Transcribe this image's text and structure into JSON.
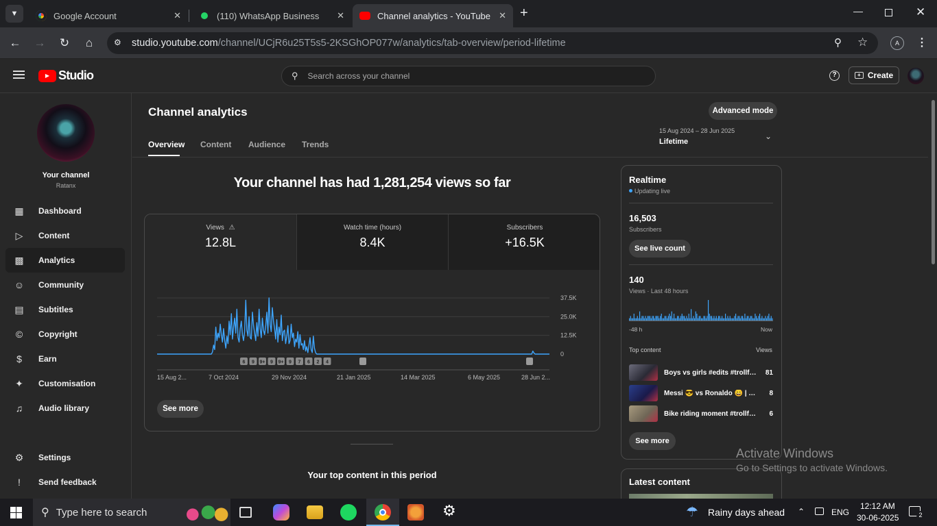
{
  "browser": {
    "tabs": [
      {
        "title": "Google Account",
        "icon": "google-icon"
      },
      {
        "title": "(110) WhatsApp Business",
        "icon": "whatsapp-icon"
      },
      {
        "title": "Channel analytics - YouTube Stu",
        "icon": "youtube-icon",
        "active": true
      }
    ],
    "url_host": "studio.youtube.com",
    "url_path": "/channel/UCjR6u25T5s5-2KSGhOP077w/analytics/tab-overview/period-lifetime"
  },
  "header": {
    "logo_text": "Studio",
    "search_placeholder": "Search across your channel",
    "create_label": "Create"
  },
  "sidebar": {
    "channel_title": "Your channel",
    "channel_name": "Ratanx",
    "items": [
      {
        "label": "Dashboard",
        "icon": "dashboard-icon"
      },
      {
        "label": "Content",
        "icon": "content-icon"
      },
      {
        "label": "Analytics",
        "icon": "analytics-icon"
      },
      {
        "label": "Community",
        "icon": "community-icon"
      },
      {
        "label": "Subtitles",
        "icon": "subtitles-icon"
      },
      {
        "label": "Copyright",
        "icon": "copyright-icon"
      },
      {
        "label": "Earn",
        "icon": "earn-icon"
      },
      {
        "label": "Customisation",
        "icon": "customisation-icon"
      },
      {
        "label": "Audio library",
        "icon": "audio-library-icon"
      }
    ],
    "settings_label": "Settings",
    "feedback_label": "Send feedback"
  },
  "main": {
    "title": "Channel analytics",
    "advanced_mode_label": "Advanced mode",
    "tabs": [
      "Overview",
      "Content",
      "Audience",
      "Trends"
    ],
    "date_range": "15 Aug 2024 – 28 Jun 2025",
    "period": "Lifetime",
    "headline": "Your channel has had 1,281,254 views so far",
    "metrics": [
      {
        "label": "Views",
        "value": "12.8L"
      },
      {
        "label": "Watch time (hours)",
        "value": "8.4K"
      },
      {
        "label": "Subscribers",
        "value": "+16.5K"
      }
    ],
    "see_more_label": "See more",
    "top_content_heading": "Your top content in this period"
  },
  "chart_data": {
    "type": "line",
    "series_color": "#3ea6ff",
    "x_tick_labels": [
      "15 Aug 2...",
      "7 Oct 2024",
      "29 Nov 2024",
      "21 Jan 2025",
      "14 Mar 2025",
      "6 May 2025",
      "28 Jun 2..."
    ],
    "y_tick_labels": [
      "37.5K",
      "25.0K",
      "12.5K",
      "0"
    ],
    "ylim": [
      0,
      37500
    ],
    "grid": true,
    "marker_labels": [
      "6",
      "9",
      "9+",
      "9",
      "9+",
      "9",
      "7",
      "6",
      "2",
      "4"
    ],
    "values": [
      0,
      0,
      0,
      0,
      0,
      0,
      0,
      0,
      0,
      0,
      0,
      0,
      0,
      0,
      0,
      0,
      0,
      0,
      0,
      0,
      0,
      0,
      0,
      0,
      0,
      0,
      0,
      0,
      0,
      0,
      0,
      0,
      0,
      0,
      0,
      0,
      0,
      0,
      0,
      0,
      0,
      0,
      0,
      0,
      0,
      0,
      0,
      0,
      0,
      0,
      1500,
      6000,
      3000,
      18000,
      9000,
      14000,
      11000,
      20000,
      13000,
      8000,
      17000,
      9000,
      4000,
      12000,
      7000,
      22000,
      13000,
      27000,
      10000,
      18000,
      24000,
      14000,
      30000,
      11000,
      8000,
      17000,
      22000,
      13000,
      9000,
      15000,
      36000,
      16000,
      12000,
      25000,
      11000,
      10000,
      28000,
      19000,
      14000,
      9000,
      21000,
      12000,
      30000,
      17000,
      11000,
      24000,
      16000,
      13000,
      19000,
      28000,
      14000,
      37500,
      20000,
      15000,
      31000,
      22000,
      17000,
      10000,
      23000,
      8000,
      18000,
      13000,
      26000,
      9000,
      15000,
      16000,
      7000,
      12000,
      19000,
      7000,
      9000,
      20000,
      11000,
      14000,
      5000,
      10000,
      8000,
      15000,
      4000,
      13000,
      6000,
      7000,
      3000,
      9000,
      2000,
      5000,
      1000,
      6000,
      11000,
      3000,
      1000,
      12000,
      4000,
      1000,
      0,
      0,
      0,
      0,
      0,
      0,
      0,
      0,
      0,
      0,
      0,
      0,
      0,
      0,
      0,
      0,
      0,
      0,
      0,
      0,
      0,
      0,
      0,
      0,
      0,
      0,
      0,
      0,
      0,
      0,
      0,
      0,
      0,
      0,
      0,
      0,
      0,
      0,
      0,
      0,
      0,
      0,
      0,
      0,
      0,
      0,
      0,
      0,
      0,
      0,
      0,
      0,
      0,
      0,
      0,
      0,
      0,
      0,
      0,
      0,
      0,
      0,
      0,
      0,
      0,
      0,
      0,
      0,
      0,
      0,
      0,
      0,
      0,
      0,
      0,
      0,
      0,
      0,
      0,
      0,
      0,
      0,
      0,
      0,
      0,
      0,
      0,
      0,
      0,
      0,
      0,
      0,
      0,
      0,
      0,
      0,
      0,
      0,
      0,
      0,
      0,
      0,
      0,
      0,
      0,
      0,
      0,
      0,
      0,
      0,
      0,
      0,
      0,
      0,
      0,
      0,
      0,
      0,
      0,
      0,
      0,
      0,
      0,
      0,
      0,
      0,
      0,
      0,
      0,
      0,
      0,
      0,
      0,
      0,
      0,
      0,
      0,
      0,
      0,
      0,
      0,
      0,
      0,
      0,
      0,
      0,
      0,
      0,
      0,
      0,
      0,
      0,
      0,
      0,
      0,
      0,
      0,
      0,
      0,
      0,
      0,
      0,
      0,
      0,
      0,
      0,
      0,
      0,
      0,
      0,
      0,
      0,
      0,
      0,
      0,
      0,
      0,
      0,
      0,
      0,
      0,
      0,
      0,
      0,
      0,
      0,
      0,
      0,
      0,
      0,
      0,
      0,
      0,
      0,
      0,
      2000,
      800,
      0,
      0,
      0,
      0,
      0,
      0,
      0,
      0,
      0,
      0,
      0,
      0,
      0,
      0
    ]
  },
  "realtime": {
    "title": "Realtime",
    "status": "Updating live",
    "subscribers_value": "16,503",
    "subscribers_label": "Subscribers",
    "see_live_label": "See live count",
    "views_value": "140",
    "views_label": "Views · Last 48 hours",
    "bar_values": [
      1,
      2,
      1,
      1,
      3,
      1,
      1,
      2,
      1,
      4,
      1,
      2,
      2,
      1,
      2,
      1,
      2,
      2,
      2,
      1,
      2,
      2,
      1,
      2,
      2,
      2,
      1,
      2,
      3,
      1,
      1,
      2,
      2,
      1,
      2,
      3,
      2,
      4,
      1,
      3,
      1,
      1,
      2,
      2,
      1,
      2,
      3,
      2,
      2,
      1,
      2,
      1,
      3,
      1,
      5,
      1,
      2,
      1,
      4,
      3,
      1,
      2,
      2,
      1,
      1,
      2,
      2,
      1,
      2,
      9,
      3,
      2,
      2,
      1,
      2,
      1,
      2,
      1,
      2,
      2,
      1,
      2,
      1,
      1,
      3,
      1,
      2,
      1,
      2,
      1,
      1,
      1,
      2,
      3,
      1,
      2,
      2,
      1,
      2,
      2,
      1,
      3,
      1,
      2,
      2,
      1,
      2,
      2,
      1,
      1,
      3,
      2,
      1,
      2,
      3,
      1,
      2,
      1,
      1,
      2,
      1,
      2,
      3,
      1,
      2,
      1
    ],
    "x_start": "-48 h",
    "x_end": "Now",
    "top_content_label": "Top content",
    "top_views_label": "Views",
    "top_content": [
      {
        "title": "Boys vs girls #edits #trollface…",
        "views": "81"
      },
      {
        "title": "Messi 😎 vs Ronaldo 😄 | wh…",
        "views": "8"
      },
      {
        "title": "Bike riding moment #trollface…",
        "views": "6"
      }
    ],
    "see_more_label": "See more"
  },
  "latest": {
    "title": "Latest content"
  },
  "watermark": {
    "line1": "Activate Windows",
    "line2": "Go to Settings to activate Windows."
  },
  "taskbar": {
    "search_placeholder": "Type here to search",
    "weather": "Rainy days ahead",
    "lang": "ENG",
    "time": "12:12 AM",
    "date": "30-06-2025",
    "notif_count": "2"
  }
}
